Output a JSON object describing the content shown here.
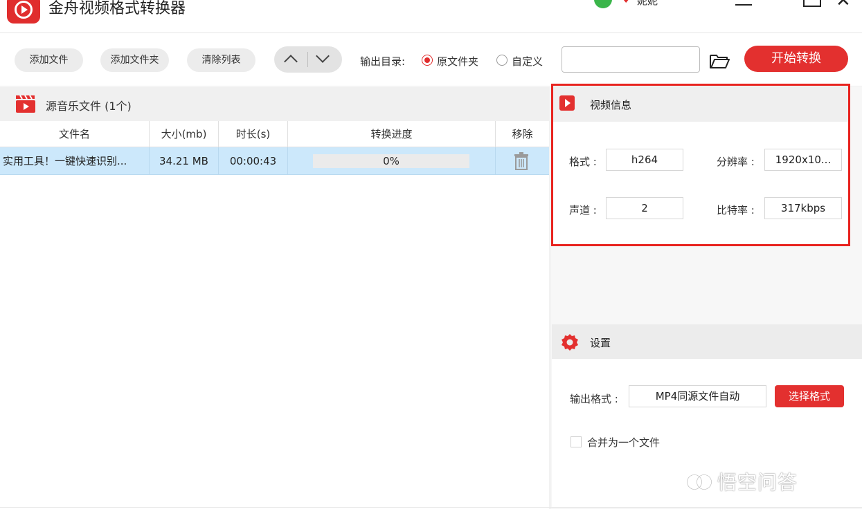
{
  "app": {
    "title": "金舟视频格式转换器"
  },
  "user": {
    "name": "妮妮"
  },
  "toolbar": {
    "add_file": "添加文件",
    "add_folder": "添加文件夹",
    "clear_list": "清除列表",
    "output_dir_label": "输出目录:",
    "radio_original": "原文件夹",
    "radio_custom": "自定义",
    "output_path": "",
    "start": "开始转换"
  },
  "file_list": {
    "title": "源音乐文件 (1个)",
    "columns": [
      "文件名",
      "大小(mb)",
      "时长(s)",
      "转换进度",
      "移除"
    ],
    "rows": [
      {
        "name": "实用工具！一键快速识别...",
        "size": "34.21 MB",
        "duration": "00:00:43",
        "progress_text": "0%",
        "progress": 0
      }
    ]
  },
  "video_info": {
    "title": "视频信息",
    "format_label": "格式 :",
    "format": "h264",
    "resolution_label": "分辨率 :",
    "resolution": "1920x10...",
    "channels_label": "声道 :",
    "channels": "2",
    "bitrate_label": "比特率 :",
    "bitrate": "317kbps"
  },
  "settings": {
    "title": "设置",
    "output_format_label": "输出格式 :",
    "output_format": "MP4同源文件自动",
    "choose_format": "选择格式",
    "merge_label": "合并为一个文件",
    "merge_checked": false
  },
  "watermark": "悟空问答",
  "colors": {
    "accent": "#e3302f",
    "highlight_border": "#e8231f",
    "row_selected": "#cce8fb"
  }
}
